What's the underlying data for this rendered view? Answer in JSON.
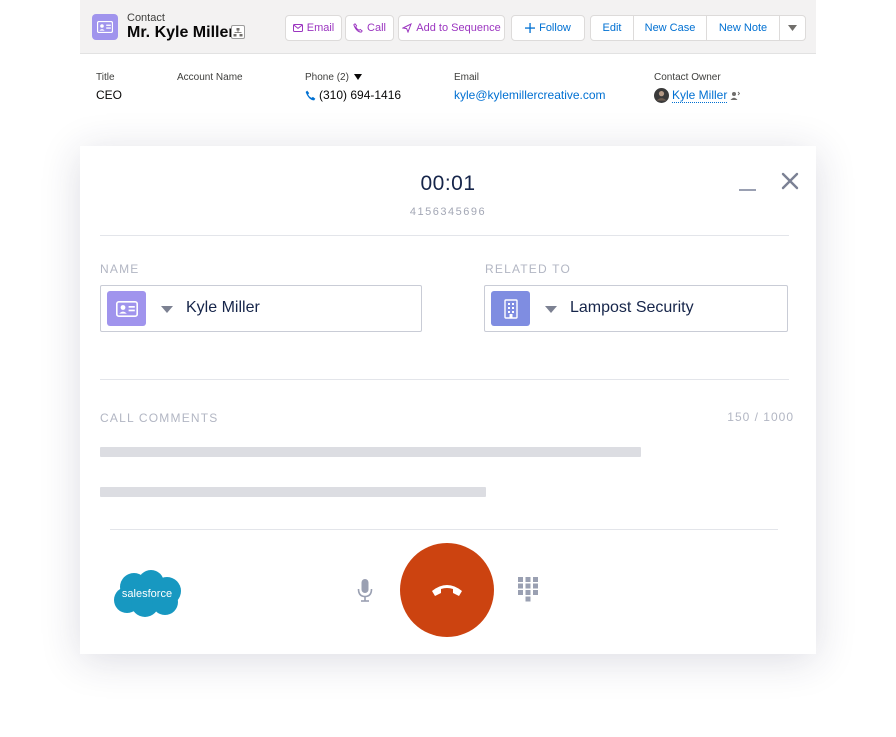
{
  "record": {
    "object_label": "Contact",
    "name": "Mr. Kyle Miller",
    "actions": {
      "email": "Email",
      "call": "Call",
      "add_to_sequence": "Add to Sequence",
      "follow": "Follow",
      "edit": "Edit",
      "new_case": "New Case",
      "new_note": "New Note"
    },
    "fields": {
      "title_label": "Title",
      "title_value": "CEO",
      "account_label": "Account Name",
      "account_value": "",
      "phone_label": "Phone (2)",
      "phone_value": "(310) 694-1416",
      "email_label": "Email",
      "email_value": "kyle@kylemillercreative.com",
      "owner_label": "Contact Owner",
      "owner_value": "Kyle Miller"
    }
  },
  "call": {
    "timer": "00:01",
    "number": "4156345696",
    "name_label": "NAME",
    "name_value": "Kyle Miller",
    "related_label": "RELATED TO",
    "related_value": "Lampost Security",
    "comments_label": "CALL COMMENTS",
    "comments_counter": "150 / 1000"
  },
  "branding": {
    "logo_text": "salesforce"
  },
  "colors": {
    "contact_icon": "#a094ed",
    "account_icon": "#7f8de1",
    "end_call": "#cc4310",
    "salesforce_blue": "#1798c1",
    "link": "#0070d2"
  },
  "icons": {
    "contact": "contact-card-icon",
    "hierarchy": "hierarchy-icon",
    "email": "envelope-icon",
    "call": "phone-icon",
    "sequence": "sequence-icon",
    "follow": "plus-icon",
    "more": "chevron-down-icon",
    "minimize": "minimize-icon",
    "close": "close-icon",
    "mic": "microphone-icon",
    "end_call": "end-call-icon",
    "keypad": "keypad-icon",
    "account": "building-icon"
  }
}
